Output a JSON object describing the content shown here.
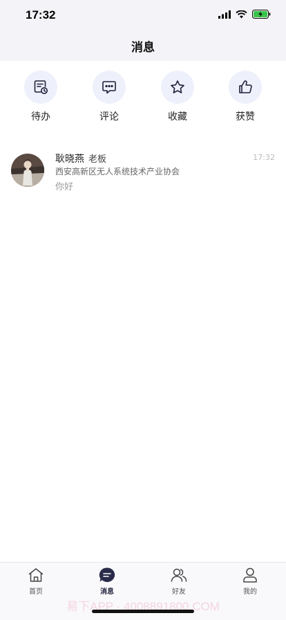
{
  "status_bar": {
    "time": "17:32"
  },
  "header": {
    "title": "消息"
  },
  "quick_actions": [
    {
      "label": "待办",
      "icon": "todo-icon"
    },
    {
      "label": "评论",
      "icon": "comment-icon"
    },
    {
      "label": "收藏",
      "icon": "star-icon"
    },
    {
      "label": "获赞",
      "icon": "thumbs-up-icon"
    }
  ],
  "messages": [
    {
      "name": "耿晓燕",
      "role": "老板",
      "organization": "西安高新区无人系统技术产业协会",
      "preview": "你好",
      "time": "17:32"
    }
  ],
  "tab_bar": {
    "active": "消息",
    "items": [
      {
        "label": "首页",
        "icon": "home-icon"
      },
      {
        "label": "消息",
        "icon": "chat-icon"
      },
      {
        "label": "好友",
        "icon": "friends-icon"
      },
      {
        "label": "我的",
        "icon": "profile-icon"
      }
    ]
  },
  "watermark": "易下APP · 4008891800.COM",
  "colors": {
    "accent": "#1e1e3a",
    "icon_bg": "#eef0fb",
    "header_bg": "#f4f4f8"
  }
}
